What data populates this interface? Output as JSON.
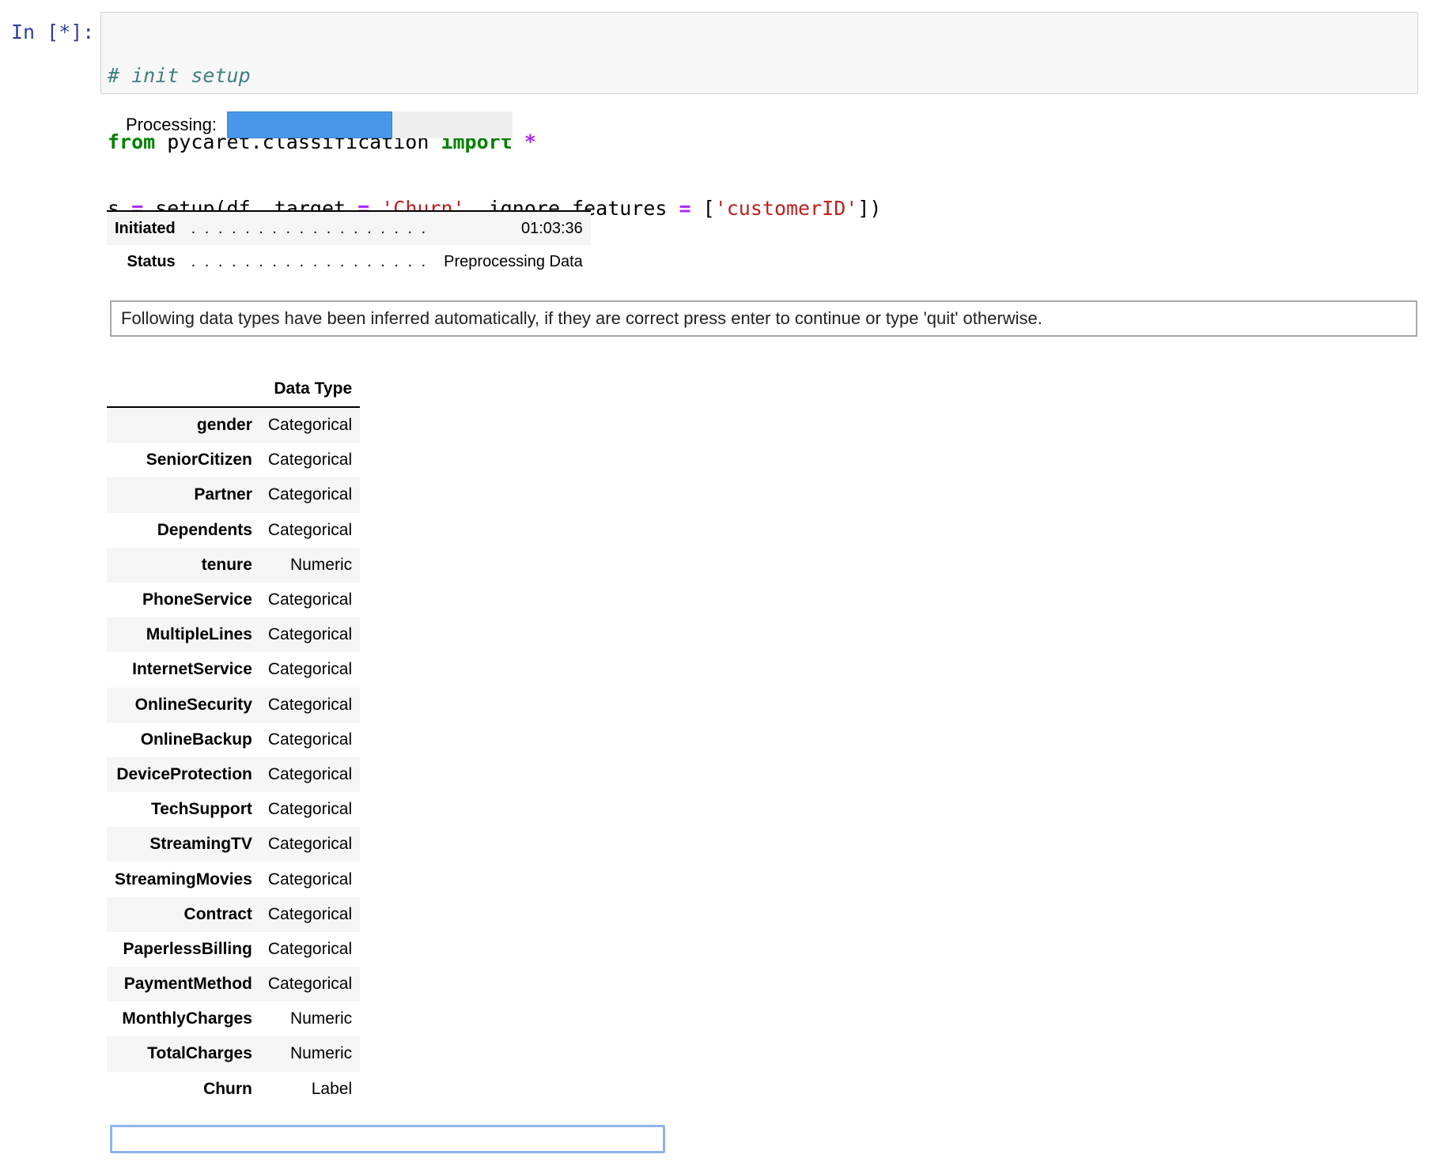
{
  "cell": {
    "prompt": "In [*]:",
    "code": {
      "line1_comment": "# init setup",
      "line2_from": "from",
      "line2_module": " pycaret.classification ",
      "line2_import": "import",
      "line2_space": " ",
      "line2_star": "*",
      "line3_a": "s ",
      "line3_eq1": "=",
      "line3_b": " setup(df, target ",
      "line3_eq2": "=",
      "line3_c": " ",
      "line3_str1": "'Churn'",
      "line3_d": ", ignore_features ",
      "line3_eq3": "=",
      "line3_e": " [",
      "line3_str2": "'customerID'",
      "line3_f": "])"
    }
  },
  "progress": {
    "label": "Processing:",
    "fraction": 0.58,
    "fill_color": "#4897ea",
    "track_color": "#eeeeee"
  },
  "status": {
    "rows": [
      {
        "key": "Initiated",
        "dots": ". . . . . . . . . . . . . . . . . .",
        "value": "01:03:36"
      },
      {
        "key": "Status",
        "dots": ". . . . . . . . . . . . . . . . . .",
        "value": "Preprocessing Data"
      }
    ]
  },
  "message": "Following data types have been inferred automatically, if they are correct press enter to continue or type 'quit' otherwise.",
  "dtypes": {
    "header": "Data Type",
    "rows": [
      {
        "name": "gender",
        "type": "Categorical"
      },
      {
        "name": "SeniorCitizen",
        "type": "Categorical"
      },
      {
        "name": "Partner",
        "type": "Categorical"
      },
      {
        "name": "Dependents",
        "type": "Categorical"
      },
      {
        "name": "tenure",
        "type": "Numeric"
      },
      {
        "name": "PhoneService",
        "type": "Categorical"
      },
      {
        "name": "MultipleLines",
        "type": "Categorical"
      },
      {
        "name": "InternetService",
        "type": "Categorical"
      },
      {
        "name": "OnlineSecurity",
        "type": "Categorical"
      },
      {
        "name": "OnlineBackup",
        "type": "Categorical"
      },
      {
        "name": "DeviceProtection",
        "type": "Categorical"
      },
      {
        "name": "TechSupport",
        "type": "Categorical"
      },
      {
        "name": "StreamingTV",
        "type": "Categorical"
      },
      {
        "name": "StreamingMovies",
        "type": "Categorical"
      },
      {
        "name": "Contract",
        "type": "Categorical"
      },
      {
        "name": "PaperlessBilling",
        "type": "Categorical"
      },
      {
        "name": "PaymentMethod",
        "type": "Categorical"
      },
      {
        "name": "MonthlyCharges",
        "type": "Numeric"
      },
      {
        "name": "TotalCharges",
        "type": "Numeric"
      },
      {
        "name": "Churn",
        "type": "Label"
      }
    ]
  },
  "input": {
    "value": ""
  }
}
